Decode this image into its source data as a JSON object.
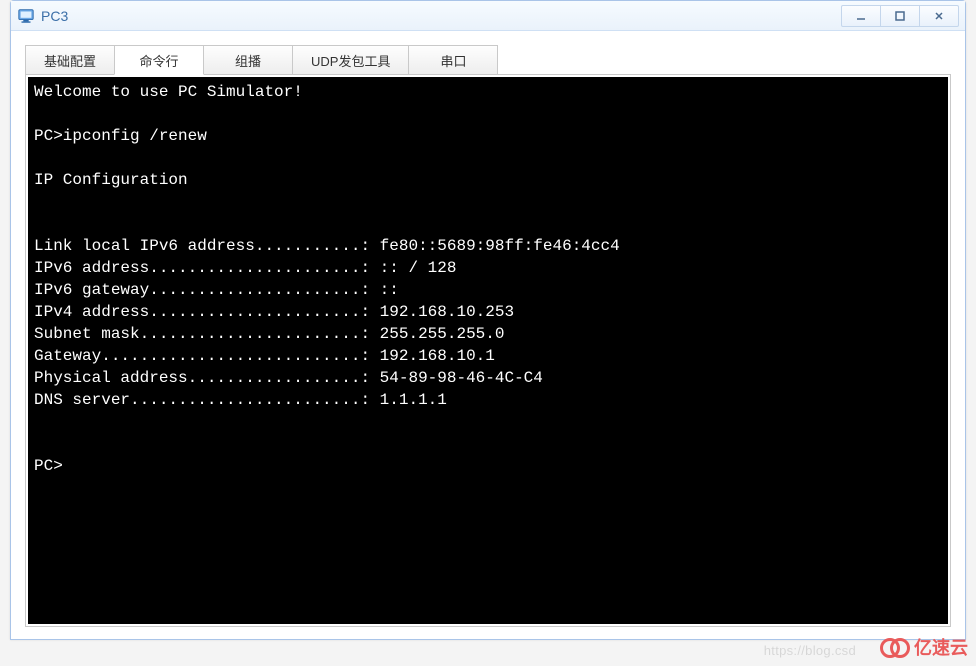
{
  "window": {
    "title": "PC3"
  },
  "tabs": [
    {
      "label": "基础配置",
      "active": false
    },
    {
      "label": "命令行",
      "active": true
    },
    {
      "label": "组播",
      "active": false
    },
    {
      "label": "UDP发包工具",
      "active": false
    },
    {
      "label": "串口",
      "active": false
    }
  ],
  "terminal": {
    "lines": [
      "Welcome to use PC Simulator!",
      "",
      "PC>ipconfig /renew",
      "",
      "IP Configuration",
      "",
      "",
      "Link local IPv6 address...........: fe80::5689:98ff:fe46:4cc4",
      "IPv6 address......................: :: / 128",
      "IPv6 gateway......................: ::",
      "IPv4 address......................: 192.168.10.253",
      "Subnet mask.......................: 255.255.255.0",
      "Gateway...........................: 192.168.10.1",
      "Physical address..................: 54-89-98-46-4C-C4",
      "DNS server........................: 1.1.1.1",
      "",
      "",
      "PC>"
    ]
  },
  "watermark": {
    "text": "亿速云",
    "ghost": "https://blog.csd"
  }
}
